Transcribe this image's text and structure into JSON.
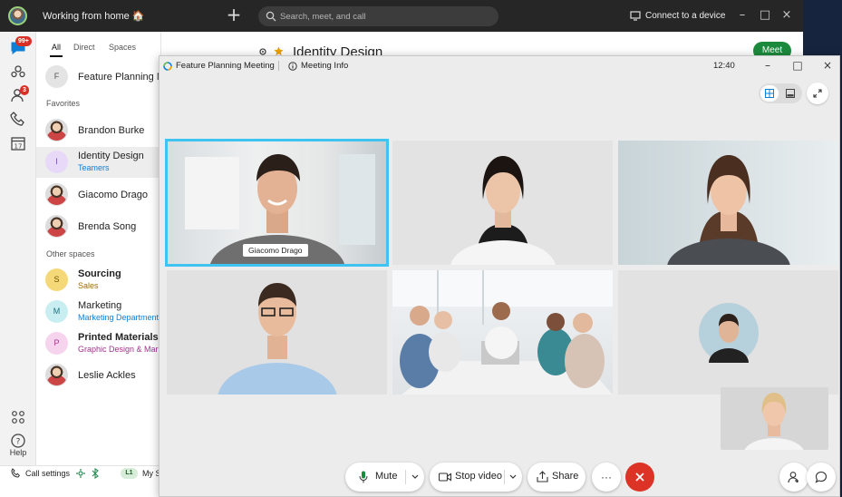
{
  "titlebar": {
    "status": "Working from home 🏠",
    "search_placeholder": "Search, meet, and call",
    "connect_label": "Connect to a device"
  },
  "rail": {
    "messaging_badge": "99+",
    "contacts_badge": "3",
    "help_label": "Help"
  },
  "list": {
    "tabs": [
      "All",
      "Direct",
      "Spaces"
    ],
    "top_item": {
      "initial": "F",
      "name": "Feature Planning M"
    },
    "favorites_label": "Favorites",
    "favorites": [
      {
        "name": "Brandon Burke",
        "sub": ""
      },
      {
        "initial": "I",
        "name": "Identity Design",
        "sub": "Teamers"
      },
      {
        "name": "Giacomo Drago",
        "sub": ""
      },
      {
        "name": "Brenda Song",
        "sub": ""
      }
    ],
    "other_label": "Other spaces",
    "others": [
      {
        "initial": "S",
        "name": "Sourcing",
        "sub": "Sales"
      },
      {
        "initial": "M",
        "name": "Marketing",
        "sub": "Marketing Department"
      },
      {
        "initial": "P",
        "name": "Printed Materials",
        "sub": "Graphic Design & Marketing"
      },
      {
        "name": "Leslie Ackles",
        "sub": ""
      }
    ],
    "footer": {
      "call_settings": "Call settings",
      "l1": "L1",
      "my_space": "My S"
    }
  },
  "space": {
    "title": "Identity Design",
    "meet_label": "Meet"
  },
  "meeting": {
    "title": "Feature Planning Meeting",
    "info_label": "Meeting Info",
    "time": "12:40",
    "active_speaker_name": "Giacomo Drago",
    "controls": {
      "mute": "Mute",
      "stop_video": "Stop video",
      "share": "Share",
      "more": "···"
    }
  },
  "colors": {
    "accent_green": "#1c8a3c",
    "active_speaker": "#3fc3f0",
    "end_call": "#dc3326",
    "badge_red": "#d93025"
  }
}
